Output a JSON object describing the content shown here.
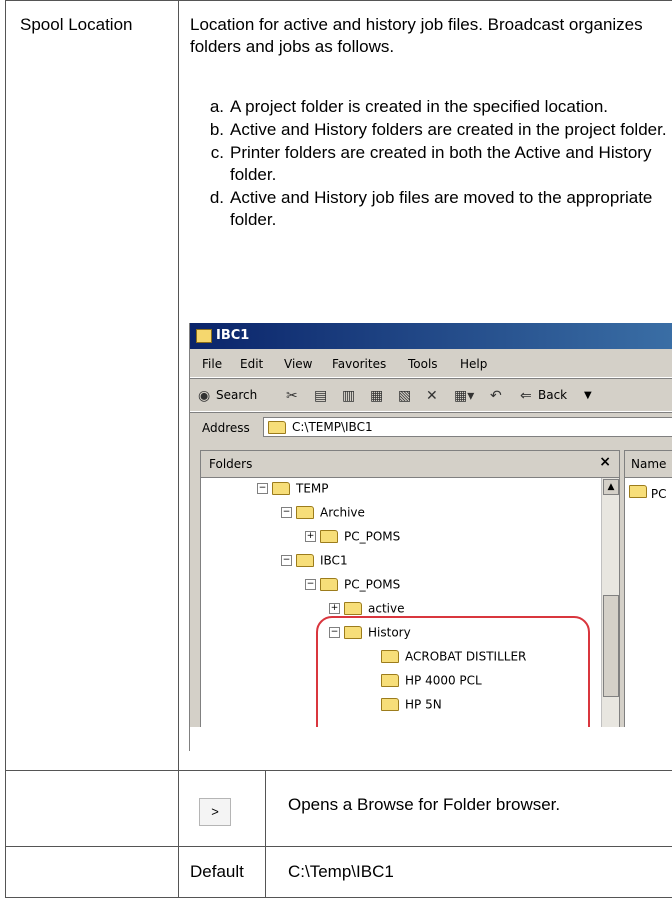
{
  "property": {
    "label": "Spool Location",
    "description": "Location for active and history job files. Broadcast organizes folders and jobs as follows.",
    "steps": [
      {
        "marker": "a.",
        "text": "A project folder is created in the specified location."
      },
      {
        "marker": "b.",
        "text": "Active and History folders are created in the project folder."
      },
      {
        "marker": "c.",
        "text": "Printer folders are created in both the Active and History folder."
      },
      {
        "marker": "d.",
        "text": "Active and History job files are moved to the appropriate folder."
      }
    ]
  },
  "explorer": {
    "title": "IBC1",
    "menu": [
      "File",
      "Edit",
      "View",
      "Favorites",
      "Tools",
      "Help"
    ],
    "toolbar": {
      "search": "Search",
      "back": "Back"
    },
    "address_label": "Address",
    "address_value": "C:\\TEMP\\IBC1",
    "folders_title": "Folders",
    "close": "×",
    "name_header": "Name",
    "name_item": "PC",
    "tree": [
      "TEMP",
      "Archive",
      "PC_POMS",
      "IBC1",
      "PC_POMS",
      "active",
      "History",
      "ACROBAT DISTILLER",
      "HP 4000 PCL",
      "HP 5N"
    ]
  },
  "browse": {
    "button": ">",
    "description": "Opens a Browse for Folder browser."
  },
  "default": {
    "label": "Default",
    "value": "C:\\Temp\\IBC1"
  },
  "colors": {
    "border": "#555555",
    "highlight": "#d9363e"
  }
}
